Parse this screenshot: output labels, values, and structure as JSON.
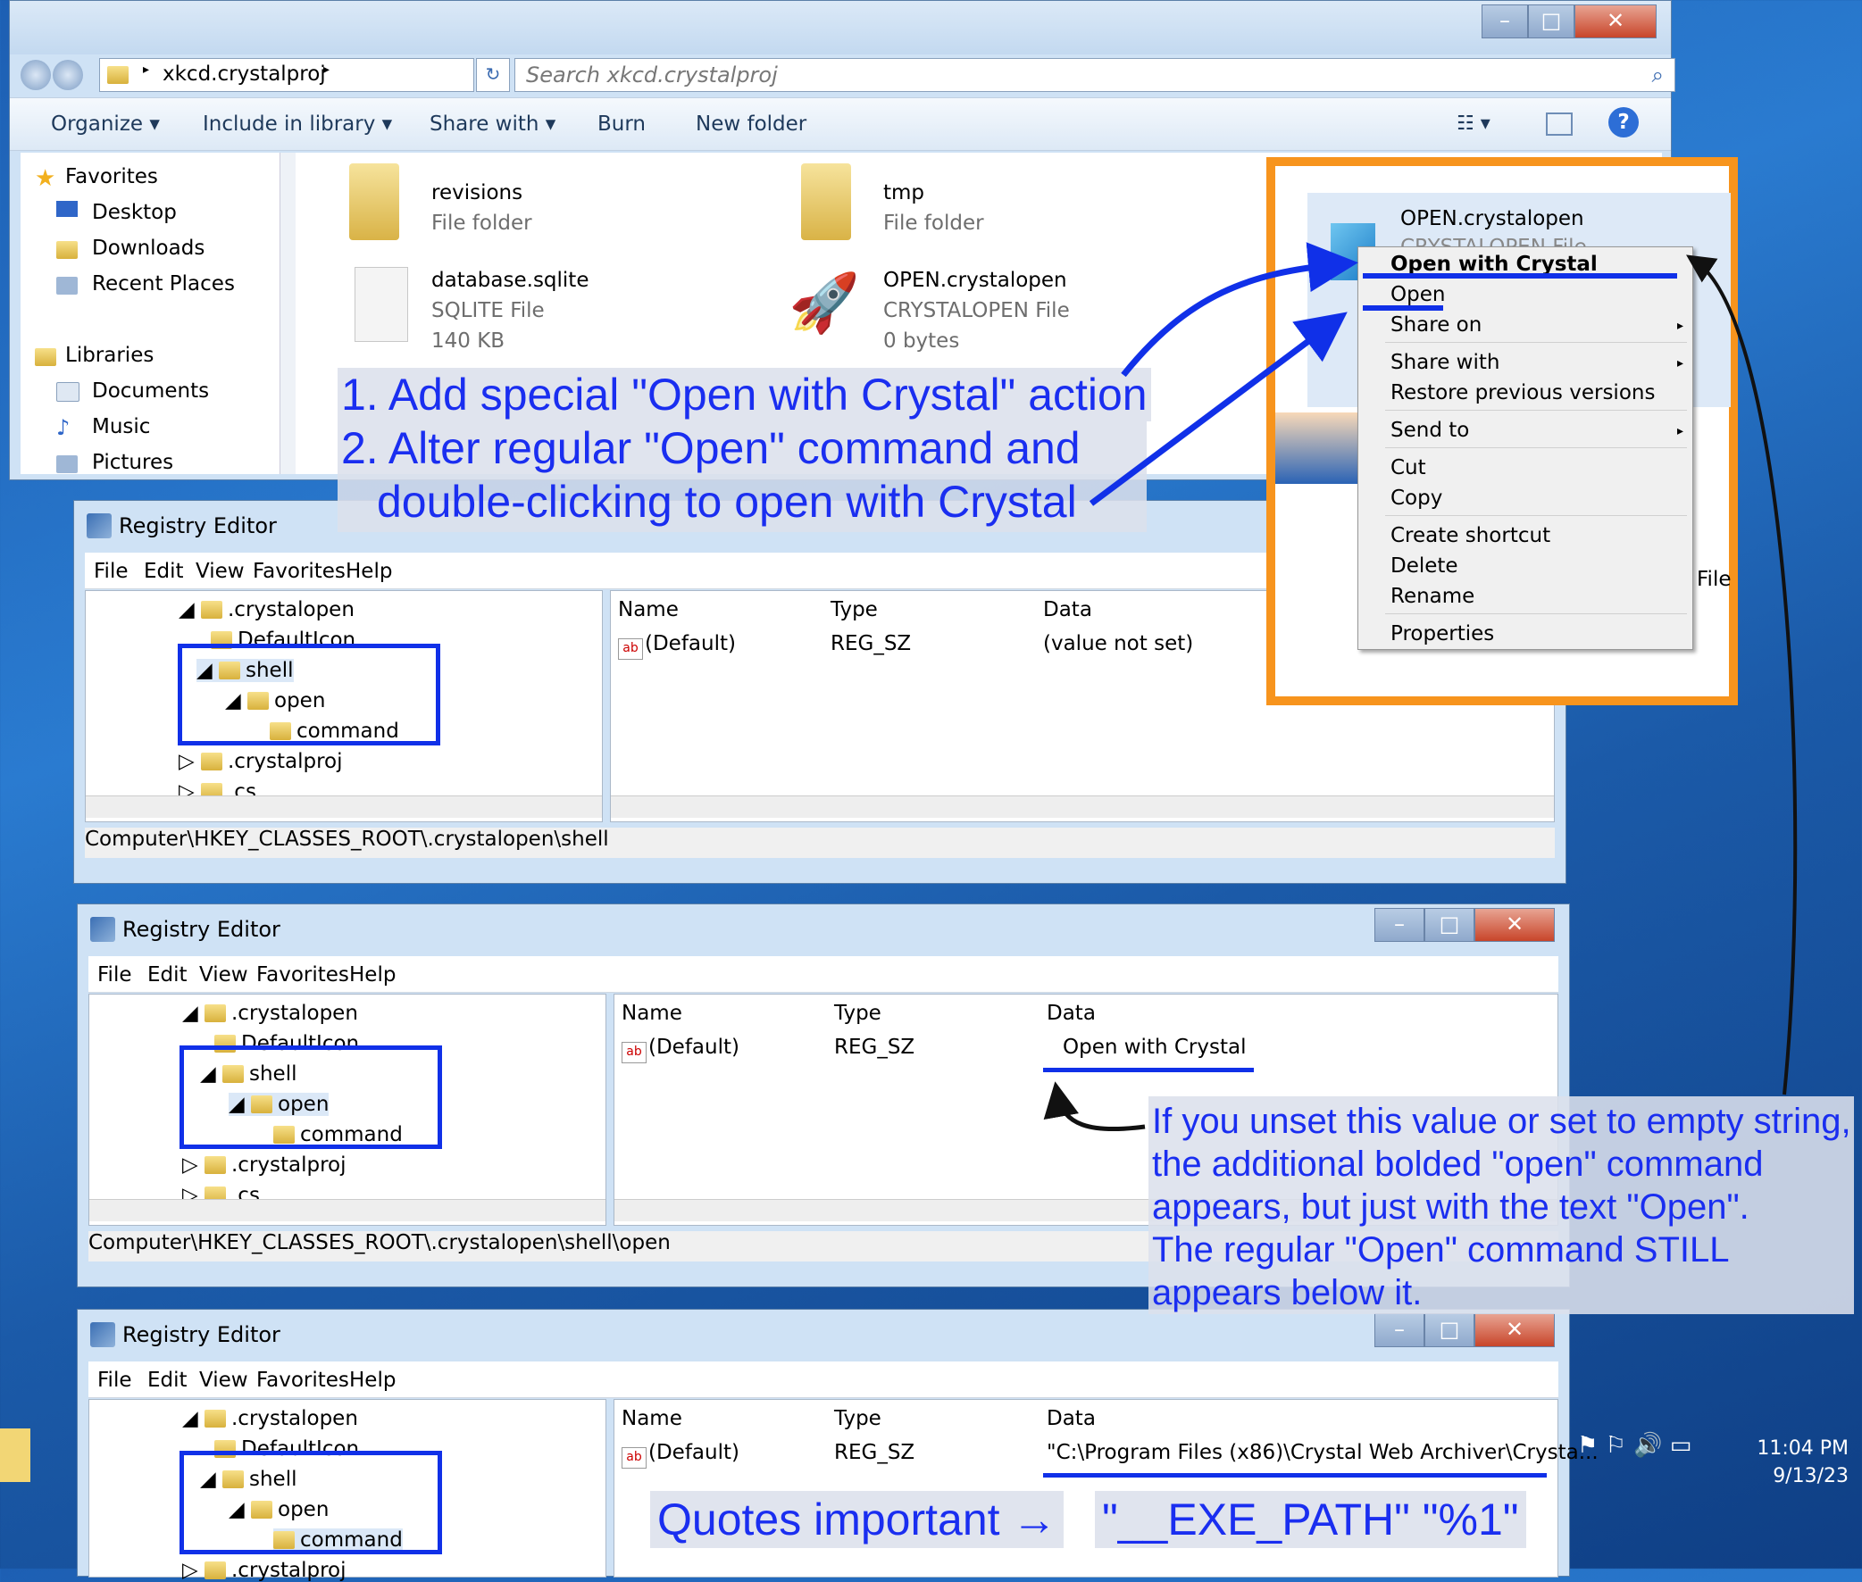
{
  "explorer": {
    "breadcrumb": "xkcd.crystalproj",
    "search_placeholder": "Search xkcd.crystalproj",
    "toolbar": [
      "Organize",
      "Include in library",
      "Share with",
      "Burn",
      "New folder"
    ],
    "nav": {
      "favorites": "Favorites",
      "fav_items": [
        "Desktop",
        "Downloads",
        "Recent Places"
      ],
      "libraries": "Libraries",
      "lib_items": [
        "Documents",
        "Music",
        "Pictures"
      ]
    },
    "files": [
      {
        "name": "revisions",
        "type": "File folder",
        "size": ""
      },
      {
        "name": "tmp",
        "type": "File folder",
        "size": ""
      },
      {
        "name": "database.sqlite",
        "type": "SQLITE File",
        "size": "140 KB"
      },
      {
        "name": "OPEN.crystalopen",
        "type": "CRYSTALOPEN File",
        "size": "0 bytes"
      }
    ],
    "window_controls": [
      "–",
      "□",
      "✕"
    ]
  },
  "callout": {
    "file_name": "OPEN.crystalopen",
    "file_type": "CRYSTALOPEN File",
    "side_text": "File",
    "menu": {
      "bold_item": "Open with Crystal",
      "items": [
        "Open",
        "Share on",
        "Share with",
        "Restore previous versions",
        "Send to",
        "Cut",
        "Copy",
        "Create shortcut",
        "Delete",
        "Rename",
        "Properties"
      ]
    }
  },
  "registry": {
    "title": "Registry Editor",
    "menu": [
      "File",
      "Edit",
      "View",
      "Favorites",
      "Help"
    ],
    "columns": [
      "Name",
      "Type",
      "Data"
    ],
    "tree": [
      ".crystalopen",
      "DefaultIcon",
      "shell",
      "open",
      "command",
      ".crystalproj",
      ".cs"
    ],
    "windows": [
      {
        "value_name": "(Default)",
        "value_type": "REG_SZ",
        "value_data": "(value not set)",
        "path": "Computer\\HKEY_CLASSES_ROOT\\.crystalopen\\shell"
      },
      {
        "value_name": "(Default)",
        "value_type": "REG_SZ",
        "value_data": "Open with Crystal",
        "path": "Computer\\HKEY_CLASSES_ROOT\\.crystalopen\\shell\\open"
      },
      {
        "value_name": "(Default)",
        "value_type": "REG_SZ",
        "value_data": "\"C:\\Program Files (x86)\\Crystal Web Archiver\\Crysta...",
        "path": ""
      }
    ]
  },
  "annotations": {
    "step1": "1. Add special \"Open with Crystal\" action",
    "step2a": "2. Alter regular \"Open\" command and",
    "step2b": "double-clicking to open with Crystal",
    "note": [
      "If you unset this value or set to empty string,",
      "the additional bolded \"open\" command",
      "appears, but just with the text \"Open\".",
      "The regular \"Open\" command STILL",
      "appears below it."
    ],
    "quotes_label": "Quotes important →",
    "quotes_value": "\"__EXE_PATH\" \"%1\""
  },
  "taskbar": {
    "time": "11:04 PM",
    "date": "9/13/23"
  },
  "colors": {
    "annotation_blue": "#1a2ef0",
    "callout_orange": "#f7941d",
    "highlight_box": "#1030e8"
  }
}
